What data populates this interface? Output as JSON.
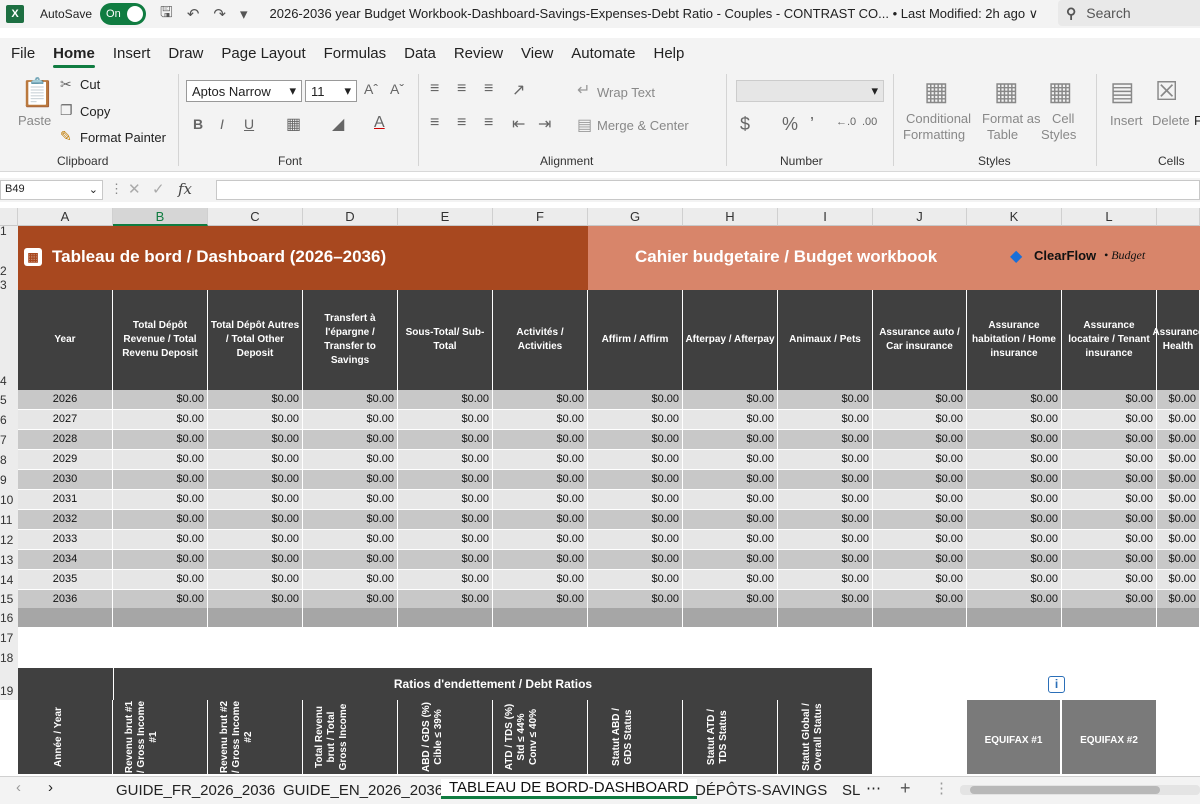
{
  "titlebar": {
    "logo": "X",
    "autosave_label": "AutoSave",
    "toggle_label": "On",
    "doc_title": "2026-2036 year Budget Workbook-Dashboard-Savings-Expenses-Debt Ratio - Couples - CONTRAST CO... • Last Modified: 2h ago ∨",
    "search_placeholder": "Search"
  },
  "menu": [
    "File",
    "Home",
    "Insert",
    "Draw",
    "Page Layout",
    "Formulas",
    "Data",
    "Review",
    "View",
    "Automate",
    "Help"
  ],
  "ribbon": {
    "paste": "Paste",
    "cut": "Cut",
    "copy": "Copy",
    "format_painter": "Format Painter",
    "clipboard": "Clipboard",
    "font_name": "Aptos Narrow",
    "font_size": "11",
    "font_group": "Font",
    "wrap_text": "Wrap Text",
    "merge_center": "Merge & Center",
    "alignment": "Alignment",
    "number": "Number",
    "cond_fmt_1": "Conditional",
    "cond_fmt_2": "Formatting",
    "fmt_table_1": "Format as",
    "fmt_table_2": "Table",
    "cell_styles_1": "Cell",
    "cell_styles_2": "Styles",
    "styles": "Styles",
    "insert": "Insert",
    "delete": "Delete",
    "format_cut": "F",
    "cells": "Cells"
  },
  "formula_bar": {
    "name_box": "B49",
    "fx": "fx"
  },
  "columns": [
    "A",
    "B",
    "C",
    "D",
    "E",
    "F",
    "G",
    "H",
    "I",
    "J",
    "K",
    "L"
  ],
  "rows": [
    "1",
    "2",
    "3",
    "4",
    "5",
    "6",
    "7",
    "8",
    "9",
    "10",
    "11",
    "12",
    "13",
    "14",
    "15",
    "16",
    "17",
    "18",
    "19"
  ],
  "banner": {
    "left_title": "Tableau de bord / Dashboard  (2026–2036)",
    "right_title": "Cahier budgetaire  / Budget workbook",
    "brand": "ClearFlow",
    "brand_suffix": "• Budget"
  },
  "table_headers": [
    "Year",
    "Total Dépôt Revenue / Total Revenu Deposit",
    "Total Dépôt Autres / Total Other Deposit",
    "Transfert à l'épargne / Transfer to Savings",
    "Sous-Total/ Sub-Total",
    "Activités / Activities",
    "Affirm / Affirm",
    "Afterpay / Afterpay",
    "Animaux / Pets",
    "Assurance auto / Car insurance",
    "Assurance habitation / Home insurance",
    "Assurance locataire / Tenant insurance",
    "Assurance Health"
  ],
  "years": [
    "2026",
    "2027",
    "2028",
    "2029",
    "2030",
    "2031",
    "2032",
    "2033",
    "2034",
    "2035",
    "2036"
  ],
  "cell_value": "$0.00",
  "ratios": {
    "title": "Ratios d'endettement / Debt Ratios",
    "headers": [
      "Année / Year",
      "Revenu brut #1 / Gross Income #1",
      "Revenu brut #2 / Gross Income #2",
      "Total Revenu brut / Total Gross Income",
      "ABD / GDS (%) Cible ≤ 39%",
      "ATD / TDS (%) Std ≤ 44% Conv ≤ 40%",
      "Statut ABD / GDS Status",
      "Statut ATD / TDS Status",
      "Statut Global / Overall Status"
    ],
    "info": "i",
    "equifax": [
      "EQUIFAX #1",
      "EQUIFAX #2"
    ]
  },
  "sheet_tabs": [
    "GUIDE_FR_2026_2036",
    "GUIDE_EN_2026_2036",
    "TABLEAU DE BORD-DASHBOARD",
    "DÉPÔTS-SAVINGS",
    "SL"
  ],
  "colors": {
    "banner_left": "#a8481f",
    "banner_right": "#d8856a",
    "header_dark": "#404040",
    "accent": "#107c41"
  }
}
